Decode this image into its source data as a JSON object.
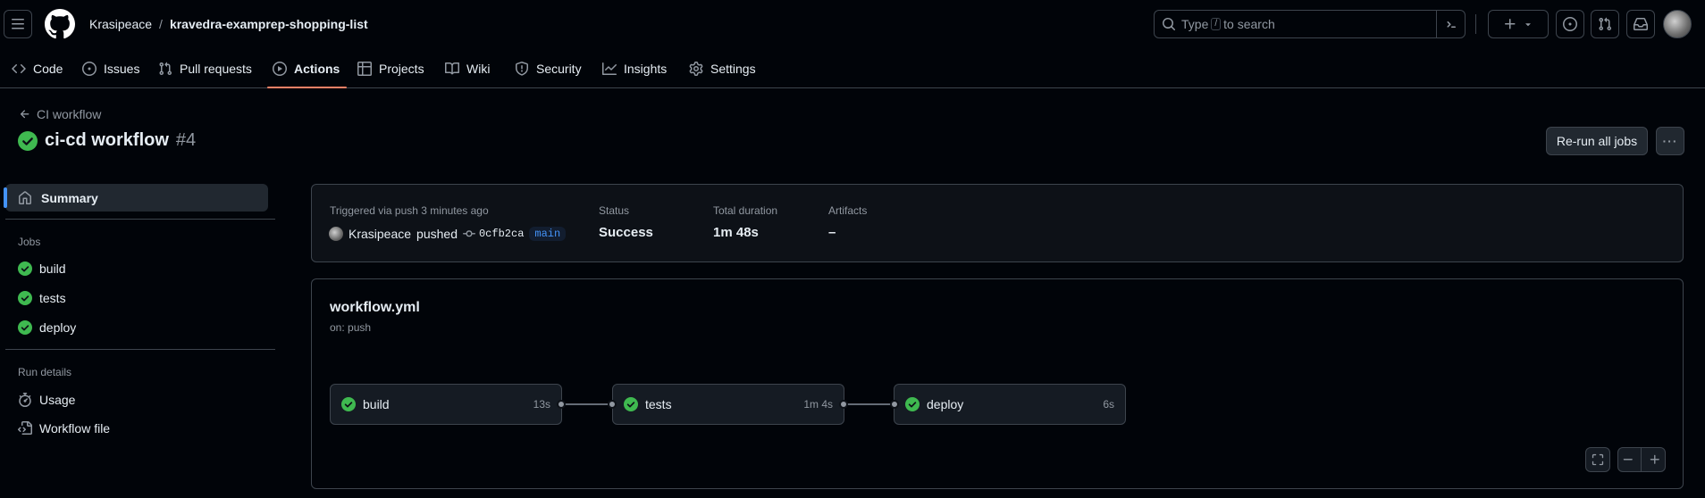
{
  "header": {
    "owner": "Krasipeace",
    "separator": "/",
    "repo": "kravedra-examprep-shopping-list",
    "search": {
      "prefix": "Type",
      "key": "/",
      "suffix": "to search"
    }
  },
  "tabs": [
    {
      "label": "Code",
      "icon": "code-icon"
    },
    {
      "label": "Issues",
      "icon": "issue-opened-icon"
    },
    {
      "label": "Pull requests",
      "icon": "git-pull-request-icon"
    },
    {
      "label": "Actions",
      "icon": "play-icon",
      "active": true
    },
    {
      "label": "Projects",
      "icon": "table-icon"
    },
    {
      "label": "Wiki",
      "icon": "book-icon"
    },
    {
      "label": "Security",
      "icon": "shield-icon"
    },
    {
      "label": "Insights",
      "icon": "graph-icon"
    },
    {
      "label": "Settings",
      "icon": "gear-icon"
    }
  ],
  "run": {
    "back_label": "CI workflow",
    "title": "ci-cd workflow",
    "number": "#4",
    "rerun_label": "Re-run all jobs",
    "more_label": "···"
  },
  "sidebar": {
    "summary_label": "Summary",
    "jobs_heading": "Jobs",
    "jobs": [
      "build",
      "tests",
      "deploy"
    ],
    "run_details_heading": "Run details",
    "details": [
      {
        "label": "Usage",
        "icon": "stopwatch-icon"
      },
      {
        "label": "Workflow file",
        "icon": "file-code-icon"
      }
    ]
  },
  "summary": {
    "trigger": "Triggered via push 3 minutes ago",
    "actor": "Krasipeace",
    "action": "pushed",
    "commit": "0cfb2ca",
    "branch": "main",
    "status_label": "Status",
    "status_value": "Success",
    "duration_label": "Total duration",
    "duration_value": "1m 48s",
    "artifacts_label": "Artifacts",
    "artifacts_value": "–"
  },
  "workflow": {
    "file": "workflow.yml",
    "trigger": "on: push",
    "jobs": [
      {
        "name": "build",
        "duration": "13s",
        "status": "success"
      },
      {
        "name": "tests",
        "duration": "1m 4s",
        "status": "success"
      },
      {
        "name": "deploy",
        "duration": "6s",
        "status": "success"
      }
    ]
  },
  "colors": {
    "background": "#010409",
    "success": "#3fb950",
    "accent_tab": "#f78166",
    "link": "#4493f8"
  }
}
